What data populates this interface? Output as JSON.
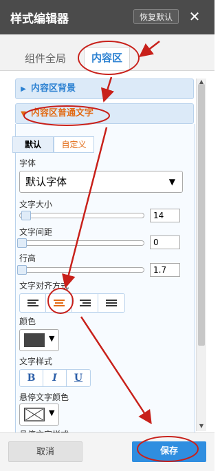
{
  "title": "样式编辑器",
  "restore_button": "恢复默认",
  "close_glyph": "✕",
  "tabs": [
    "组件全局",
    "内容区"
  ],
  "sections": [
    {
      "label": "内容区背景",
      "caret": "▶"
    },
    {
      "label": "内容区普通文字",
      "caret": "▼"
    }
  ],
  "mode_buttons": {
    "default": "默认",
    "custom": "自定义"
  },
  "font": {
    "label": "字体",
    "value": "默认字体",
    "arrow": "▼"
  },
  "font_size": {
    "label": "文字大小",
    "value": "14"
  },
  "letter_spacing": {
    "label": "文字间距",
    "value": "0"
  },
  "line_height": {
    "label": "行高",
    "value": "1.7"
  },
  "text_align": {
    "label": "文字对齐方式",
    "options": [
      "left-align",
      "center-align",
      "right-align",
      "justify-align"
    ],
    "selected": "center-align"
  },
  "color": {
    "label": "颜色",
    "value": "#444444",
    "arrow": "▼"
  },
  "text_style": {
    "label": "文字样式",
    "buttons": [
      "B",
      "I",
      "U"
    ]
  },
  "hover_color": {
    "label": "悬停文字颜色",
    "arrow": "▼"
  },
  "hover_style": {
    "label": "悬停文字样式"
  },
  "footer": {
    "cancel": "取消",
    "save": "保存"
  },
  "colors": {
    "accent": "#2d82d2",
    "highlight": "#e26b15",
    "annotation": "#c8201a"
  }
}
